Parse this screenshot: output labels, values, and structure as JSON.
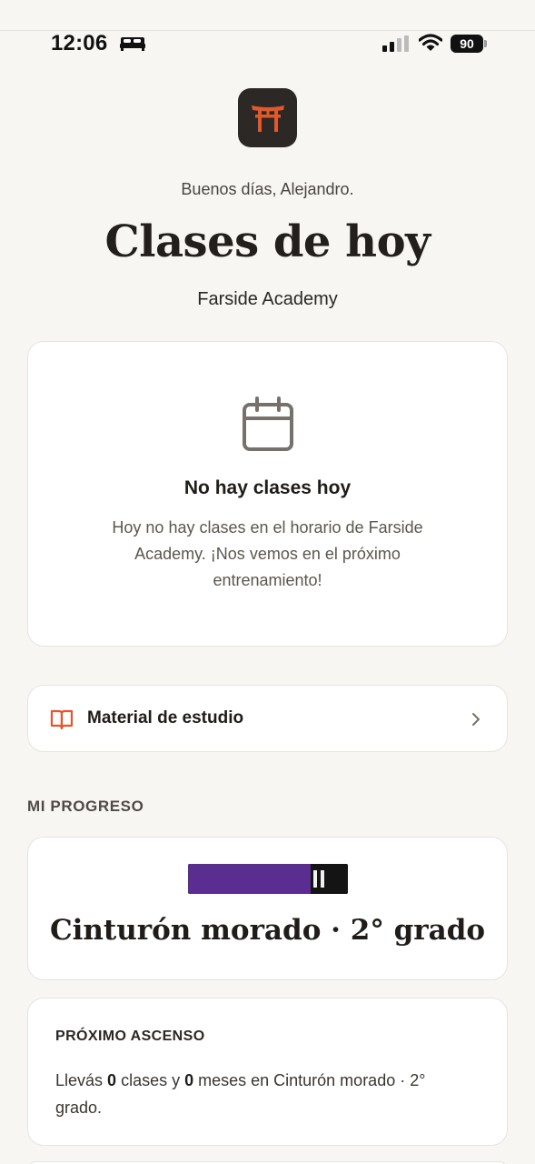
{
  "status_bar": {
    "time": "12:06",
    "battery": "90",
    "icons": [
      "bed-icon",
      "signal-icon",
      "wifi-icon",
      "battery-icon"
    ]
  },
  "header": {
    "logo_icon": "torii-gate-icon",
    "greeting": "Buenos días, Alejandro.",
    "title": "Clases de hoy",
    "academy": "Farside Academy"
  },
  "empty_state": {
    "icon": "calendar-icon",
    "title": "No hay clases hoy",
    "text": "Hoy no hay clases en el horario de Farside Academy. ¡Nos vemos en el próximo entrenamiento!"
  },
  "material": {
    "icon": "book-icon",
    "label": "Material de estudio"
  },
  "progress": {
    "section_label": "MI PROGRESO",
    "belt_name": "Cinturón morado · 2° grado",
    "belt_color": "#5a2d91",
    "belt_stripes": 2
  },
  "next_promotion": {
    "label": "PRÓXIMO ASCENSO",
    "text_prefix": "Llevás ",
    "classes": "0",
    "text_middle": " clases y ",
    "months": "0",
    "text_suffix": " meses en Cinturón morado · 2° grado."
  },
  "colors": {
    "accent": "#e0582c",
    "background": "#f7f6f3",
    "card": "#ffffff"
  }
}
